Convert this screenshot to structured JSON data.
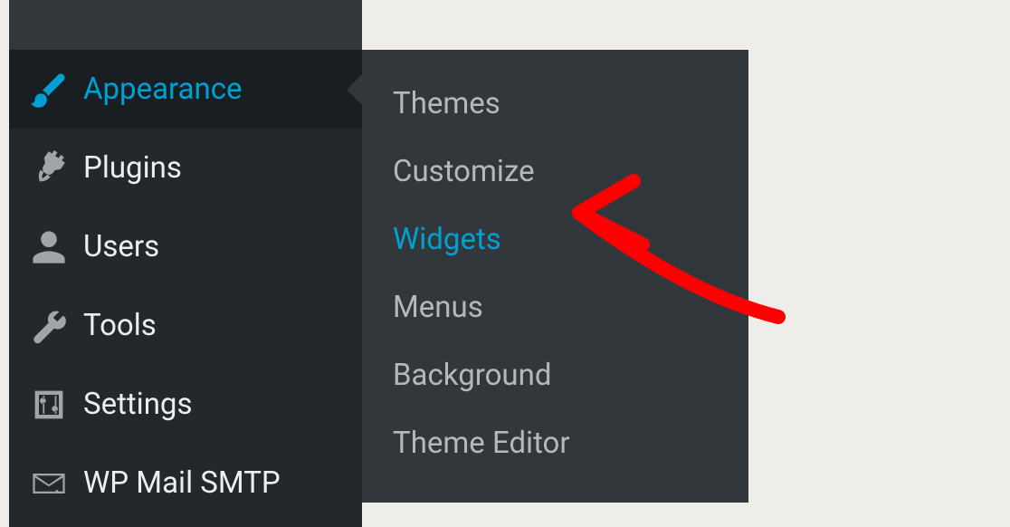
{
  "sidebar": {
    "items": [
      {
        "label": "Appearance",
        "icon": "brush",
        "active": true
      },
      {
        "label": "Plugins",
        "icon": "plug",
        "active": false
      },
      {
        "label": "Users",
        "icon": "user",
        "active": false
      },
      {
        "label": "Tools",
        "icon": "wrench",
        "active": false
      },
      {
        "label": "Settings",
        "icon": "sliders",
        "active": false
      },
      {
        "label": "WP Mail SMTP",
        "icon": "mail",
        "active": false
      }
    ]
  },
  "submenu": {
    "items": [
      {
        "label": "Themes",
        "highlighted": false
      },
      {
        "label": "Customize",
        "highlighted": false
      },
      {
        "label": "Widgets",
        "highlighted": true
      },
      {
        "label": "Menus",
        "highlighted": false
      },
      {
        "label": "Background",
        "highlighted": false
      },
      {
        "label": "Theme Editor",
        "highlighted": false
      }
    ]
  },
  "annotation": {
    "color": "#ff0000"
  }
}
